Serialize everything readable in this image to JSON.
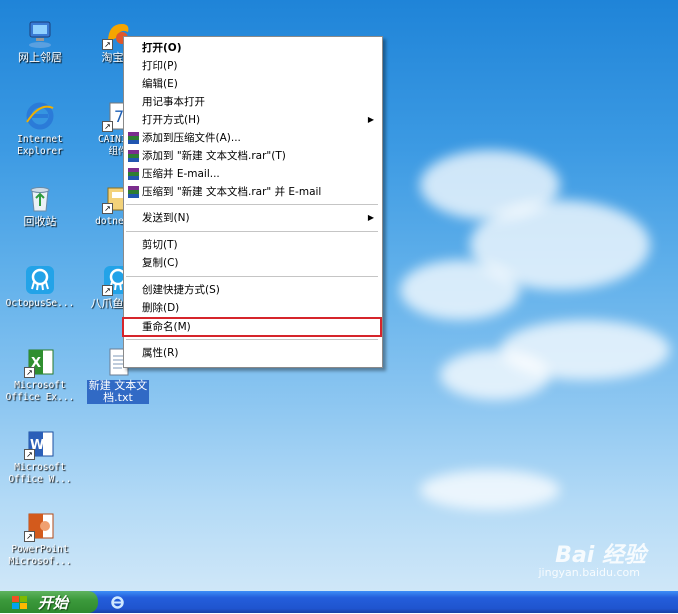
{
  "desktop_icons": [
    {
      "label": "网上邻居"
    },
    {
      "label": "淘宝网"
    },
    {
      "label": "Internet\nExplorer"
    },
    {
      "label": "CAINIAO\n组件"
    },
    {
      "label": "回收站"
    },
    {
      "label": "dotnetfx"
    },
    {
      "label": "OctopusSe..."
    },
    {
      "label": "八爪鱼采集"
    },
    {
      "label": "Microsoft\nOffice Ex..."
    },
    {
      "label": "新建 文本文\n档.txt"
    },
    {
      "label": "Microsoft\nOffice W..."
    },
    {
      "label": "PowerPoint\nMicrosof..."
    }
  ],
  "context_menu": {
    "items": [
      {
        "label": "打开(O)"
      },
      {
        "label": "打印(P)"
      },
      {
        "label": "编辑(E)"
      },
      {
        "label": "用记事本打开"
      },
      {
        "label": "打开方式(H)"
      },
      {
        "label": "添加到压缩文件(A)..."
      },
      {
        "label": "添加到 \"新建 文本文档.rar\"(T)"
      },
      {
        "label": "压缩并 E-mail..."
      },
      {
        "label": "压缩到 \"新建 文本文档.rar\" 并 E-mail"
      },
      {
        "label": "发送到(N)"
      },
      {
        "label": "剪切(T)"
      },
      {
        "label": "复制(C)"
      },
      {
        "label": "创建快捷方式(S)"
      },
      {
        "label": "删除(D)"
      },
      {
        "label": "重命名(M)"
      },
      {
        "label": "属性(R)"
      }
    ],
    "highlighted_item": "重命名(M)",
    "highlight_color": "#d6252b"
  },
  "taskbar": {
    "start_label": "开始"
  },
  "watermark": {
    "brand": "Bai 经验",
    "url": "jingyan.baidu.com"
  }
}
